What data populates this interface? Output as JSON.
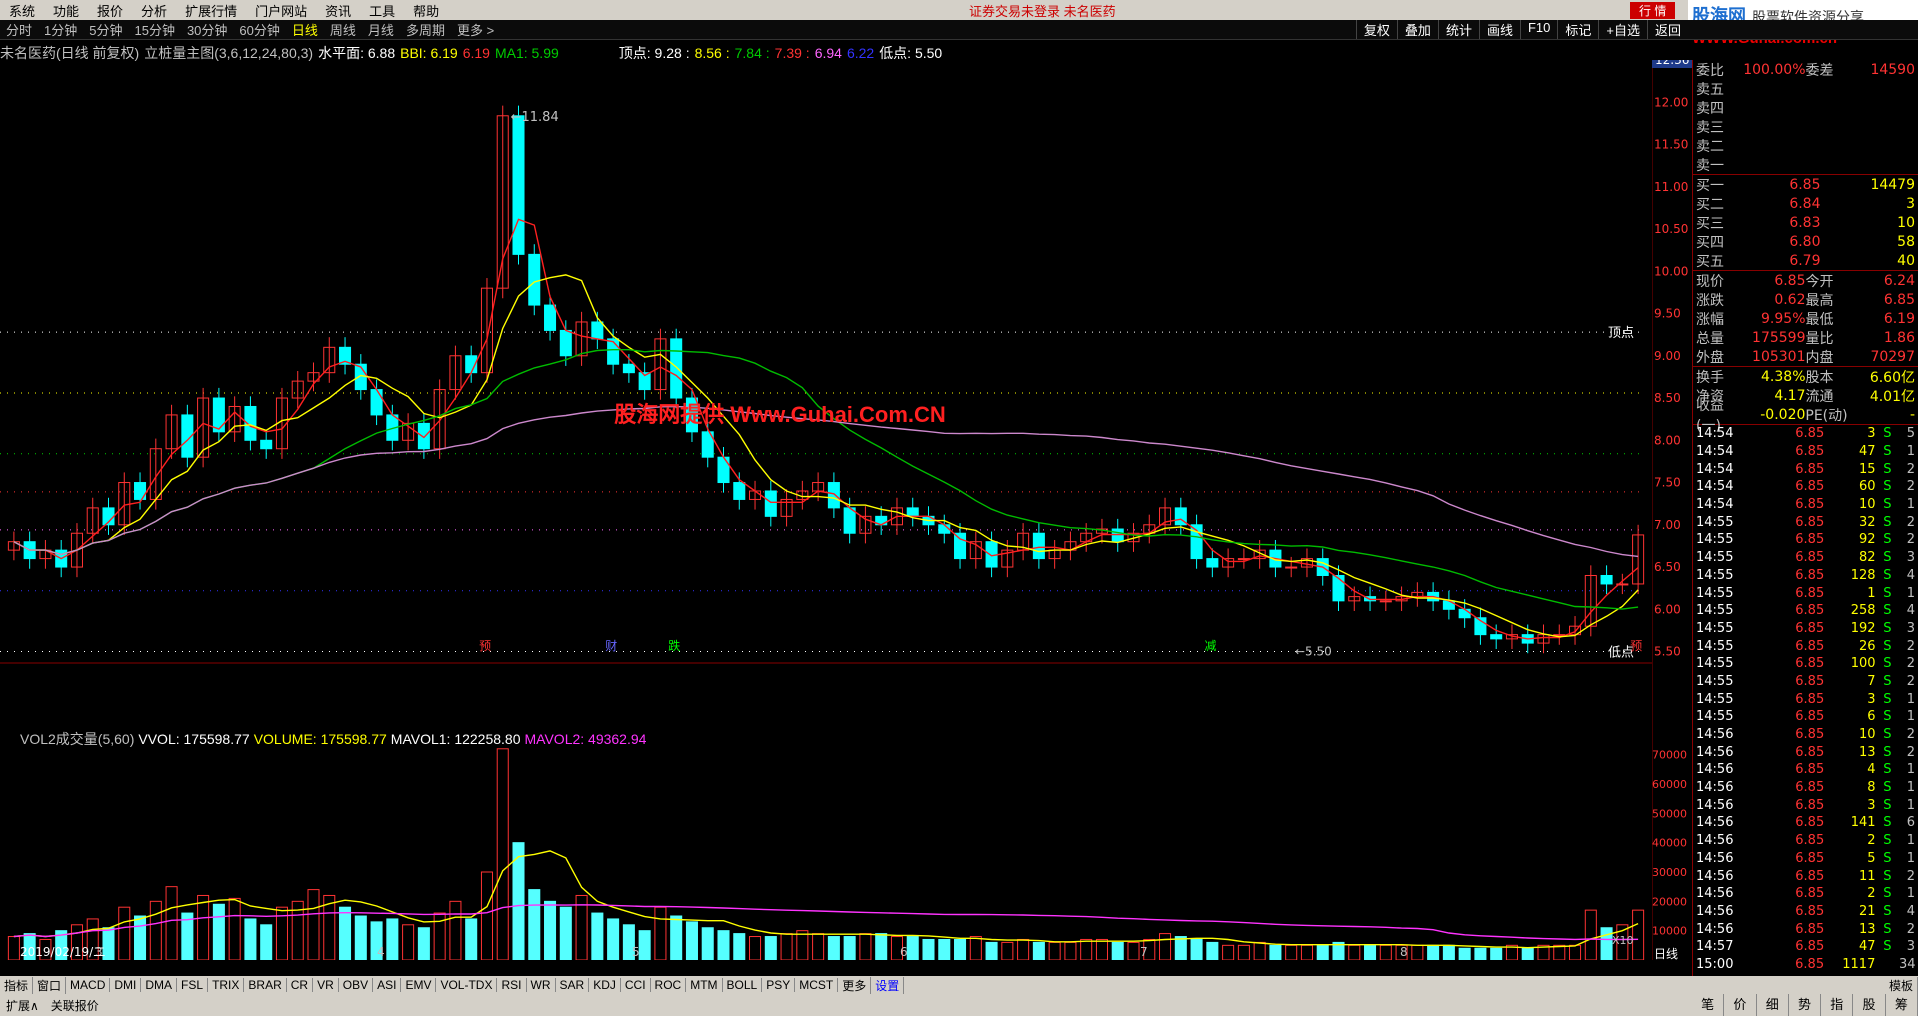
{
  "menu": [
    "系统",
    "功能",
    "报价",
    "分析",
    "扩展行情",
    "门户网站",
    "资讯",
    "工具",
    "帮助"
  ],
  "notice": "证券交易未登录  未名医药",
  "brand": {
    "logo": "股海网",
    "tagline": "股票软件资源分享",
    "url": "WWW.Guhai.com.cn",
    "hq": "行 情"
  },
  "periods": [
    "分时",
    "1分钟",
    "5分钟",
    "15分钟",
    "30分钟",
    "60分钟",
    "日线",
    "周线",
    "月线",
    "多周期",
    "更多 >"
  ],
  "active_period": "日线",
  "tools": [
    "复权",
    "叠加",
    "统计",
    "画线",
    "F10",
    "标记",
    "+自选",
    "返回"
  ],
  "info": {
    "stock": "未名医药(日线 前复权)",
    "indicator": "立桩量主图(3,6,12,24,80,3)",
    "shuiping": "水平面: 6.88",
    "bbi": "BBI: 6.19",
    "v1": "6.19",
    "ma1": "MA1: 5.99",
    "topline": "顶点: 9.28 :",
    "t2": "8.56 :",
    "t3": "7.84 :",
    "t4": "7.39 :",
    "t5": "6.94",
    "t6": "6.22",
    "lowline": "低点: 5.50"
  },
  "labels": {
    "top": "顶点",
    "low": "低点",
    "high": "11.84",
    "low_val": "5.50",
    "cur": "12.36"
  },
  "vol_info": {
    "title": "VOL2成交量(5,60)",
    "vvol": "VVOL: 175598.77",
    "volume": "VOLUME: 175598.77",
    "mavol1": "MAVOL1: 122258.80",
    "mavol2": "MAVOL2: 49362.94"
  },
  "date_label": "2019/02/19/二",
  "months": [
    "3",
    "4",
    "5",
    "6",
    "7",
    "8"
  ],
  "x10": "X10",
  "marks": [
    "预",
    "财",
    "跌",
    "减",
    "预",
    "涨"
  ],
  "indicators": [
    "指标",
    "窗口",
    "MACD",
    "DMI",
    "DMA",
    "FSL",
    "TRIX",
    "BRAR",
    "CR",
    "VR",
    "OBV",
    "ASI",
    "EMV",
    "VOL-TDX",
    "RSI",
    "WR",
    "SAR",
    "KDJ",
    "CCI",
    "ROC",
    "MTM",
    "BOLL",
    "PSY",
    "MCST",
    "更多",
    "设置"
  ],
  "bottom": [
    "扩展∧",
    "关联报价"
  ],
  "templ": "模板",
  "rlabel": "日线",
  "watermark": "股海网提供 Www.Guhai.Com.CN",
  "chart_data": {
    "type": "candlestick",
    "ylim": [
      5.4,
      12.5
    ],
    "yticks": [
      "12.00",
      "11.50",
      "11.00",
      "10.50",
      "10.00",
      "9.50",
      "9.00",
      "8.50",
      "8.00",
      "7.50",
      "7.00",
      "6.50",
      "6.00",
      "5.50"
    ],
    "vticks": [
      "70000",
      "60000",
      "50000",
      "40000",
      "30000",
      "20000",
      "10000"
    ],
    "close": [
      6.8,
      6.6,
      6.7,
      6.5,
      6.9,
      7.2,
      7.0,
      7.5,
      7.3,
      7.9,
      8.3,
      7.8,
      8.5,
      8.1,
      8.4,
      8.0,
      7.9,
      8.5,
      8.7,
      8.8,
      9.1,
      8.9,
      8.6,
      8.3,
      8.0,
      8.2,
      7.9,
      8.6,
      9.0,
      8.8,
      9.8,
      11.84,
      10.2,
      9.6,
      9.3,
      9.0,
      9.4,
      9.2,
      8.9,
      8.8,
      8.6,
      9.2,
      8.5,
      8.1,
      7.8,
      7.5,
      7.3,
      7.4,
      7.1,
      7.3,
      7.4,
      7.5,
      7.2,
      6.9,
      7.1,
      7.0,
      7.2,
      7.1,
      7.0,
      6.9,
      6.6,
      6.8,
      6.5,
      6.7,
      6.9,
      6.6,
      6.7,
      6.8,
      6.9,
      6.95,
      6.8,
      6.9,
      7.0,
      7.2,
      7.0,
      6.6,
      6.5,
      6.6,
      6.6,
      6.7,
      6.5,
      6.5,
      6.6,
      6.4,
      6.1,
      6.15,
      6.1,
      6.1,
      6.15,
      6.2,
      6.1,
      6.0,
      5.9,
      5.7,
      5.65,
      5.7,
      5.6,
      5.7,
      5.7,
      5.8,
      6.4,
      6.3,
      6.3,
      6.88
    ],
    "volume": [
      8,
      9,
      7,
      10,
      12,
      14,
      11,
      18,
      15,
      20,
      25,
      16,
      22,
      19,
      21,
      14,
      12,
      18,
      20,
      24,
      22,
      18,
      15,
      13,
      14,
      12,
      11,
      16,
      20,
      14,
      30,
      72,
      40,
      24,
      20,
      18,
      22,
      16,
      14,
      12,
      10,
      18,
      15,
      13,
      11,
      10,
      9,
      8,
      8,
      9,
      10,
      9,
      8,
      8,
      9,
      9,
      8,
      8,
      7,
      7,
      7,
      8,
      6,
      6,
      7,
      6,
      6,
      6,
      7,
      7,
      6,
      6,
      7,
      9,
      8,
      7,
      6,
      5,
      5,
      6,
      5,
      5,
      5,
      5,
      6,
      5,
      5,
      5,
      5,
      5,
      5,
      5,
      4,
      4,
      4,
      5,
      4,
      5,
      5,
      5,
      17,
      11,
      12,
      17
    ]
  }
}
